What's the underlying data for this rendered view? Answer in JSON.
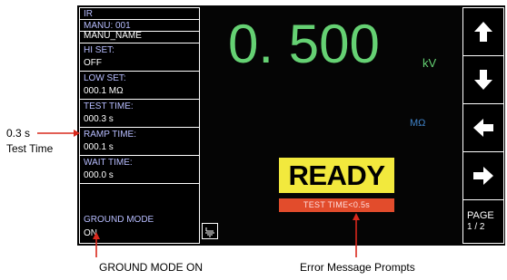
{
  "screen": {
    "left_menu": {
      "mode": "IR",
      "manu": "MANU: 001",
      "manu_name": "MANU_NAME",
      "items": [
        {
          "title": "HI SET:",
          "value": "OFF"
        },
        {
          "title": "LOW SET:",
          "value": "000.1 MΩ"
        },
        {
          "title": "TEST TIME:",
          "value": "000.3 s"
        },
        {
          "title": "RAMP TIME:",
          "value": "000.1 s"
        },
        {
          "title": "WAIT TIME:",
          "value": "000.0 s"
        },
        {
          "title": "GROUND MODE",
          "value": "ON"
        }
      ]
    },
    "reading": {
      "voltage": "0. 500",
      "voltage_unit": "kV",
      "resistance_unit": "MΩ"
    },
    "status": {
      "ready": "READY",
      "error": "TEST TIME<0.5s"
    },
    "right_panel": {
      "page_label": "PAGE",
      "page_number": "1 / 2"
    },
    "colors": {
      "screen_bg": "#050505",
      "voltage_green": "#65d173",
      "label_lavender": "#b7bdff",
      "ready_yellow": "#f2e93d",
      "error_red": "#e24c2c",
      "unit_blue": "#3f82c7"
    },
    "icons": {
      "ground": "ground-icon",
      "up": "arrow-up-icon",
      "down": "arrow-down-icon",
      "left": "arrow-left-icon",
      "right": "arrow-right-icon"
    }
  },
  "annotations": {
    "test_time_value": "0.3 s",
    "test_time_label": "Test Time",
    "ground_mode": "GROUND MODE ON",
    "error_message": "Error Message Prompts"
  }
}
